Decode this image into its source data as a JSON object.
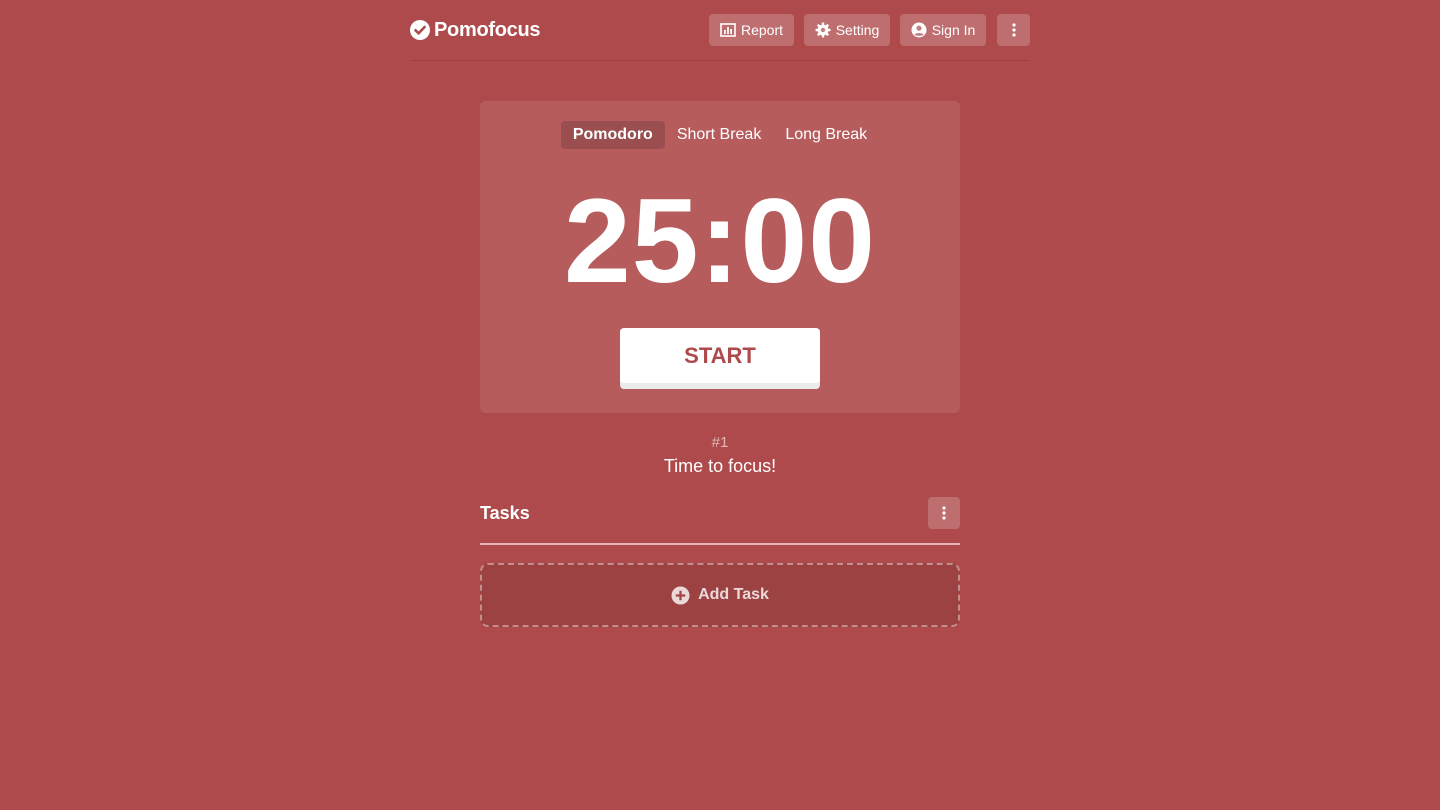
{
  "colors": {
    "background": "#ae4a4b",
    "accent": "#ffffff"
  },
  "header": {
    "logo_text": "Pomofocus",
    "logo_icon": "check-circle-icon",
    "buttons": [
      {
        "label": "Report",
        "icon": "bar-chart-icon"
      },
      {
        "label": "Setting",
        "icon": "gear-icon"
      },
      {
        "label": "Sign In",
        "icon": "user-circle-icon"
      },
      {
        "label": "",
        "icon": "more-vertical-icon"
      }
    ]
  },
  "timer": {
    "modes": [
      "Pomodoro",
      "Short Break",
      "Long Break"
    ],
    "active_mode": "Pomodoro",
    "time": "25:00",
    "start_label": "START"
  },
  "status": {
    "counter": "#1",
    "message": "Time to focus!"
  },
  "tasks": {
    "title": "Tasks",
    "add_label": "Add Task",
    "menu_icon": "more-vertical-icon",
    "add_icon": "plus-circle-icon"
  }
}
